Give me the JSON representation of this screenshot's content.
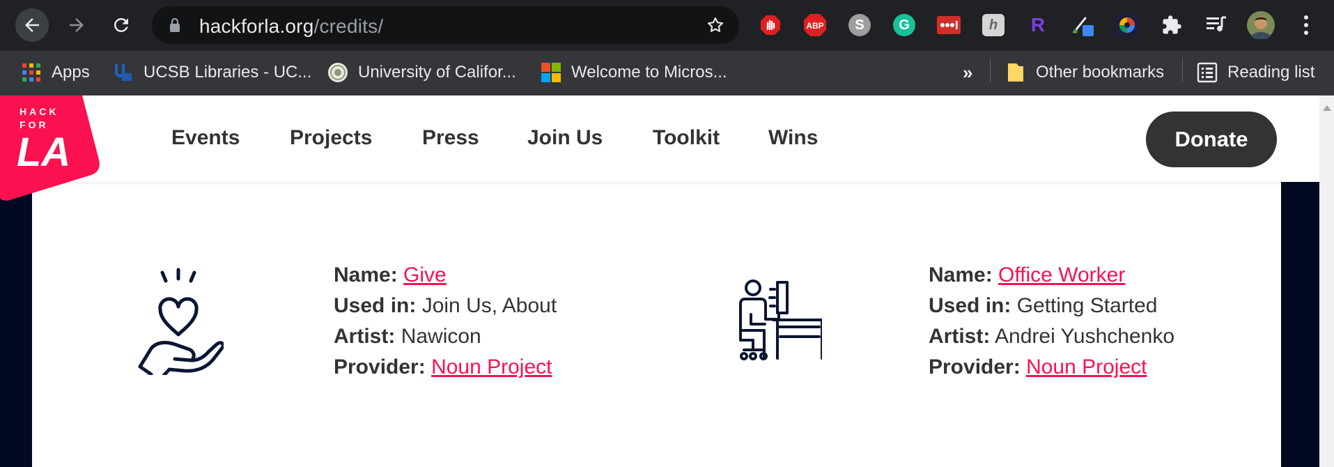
{
  "browser": {
    "url_domain": "hackforla.org",
    "url_path": "/credits/",
    "bookmarks": [
      {
        "label": "Apps"
      },
      {
        "label": "UCSB Libraries - UC..."
      },
      {
        "label": "University of Califor..."
      },
      {
        "label": "Welcome to Micros..."
      }
    ],
    "overflow_label": "»",
    "other_bookmarks": "Other bookmarks",
    "reading_list": "Reading list",
    "extensions": [
      "adblock-hand-icon",
      "abp-icon",
      "skype-icon",
      "grammarly-icon",
      "lastpass-icon",
      "honey-icon",
      "readwise-icon",
      "eyedropper-icon",
      "color-wheel-icon",
      "extensions-puzzle-icon",
      "media-queue-icon",
      "profile-avatar"
    ],
    "ext_labels": {
      "abp": "ABP",
      "s": "S",
      "g": "G",
      "honey": "h",
      "r": "R"
    }
  },
  "site": {
    "logo": {
      "line1": "HACK",
      "line2": "FOR",
      "line3": "LA",
      "color": "#fa114f"
    },
    "nav": [
      "Events",
      "Projects",
      "Press",
      "Join Us",
      "Toolkit",
      "Wins"
    ],
    "donate_label": "Donate",
    "colors": {
      "accent": "#fa114f",
      "navy": "#020a23",
      "text": "#333333"
    }
  },
  "credits": [
    {
      "icon": "give-heart-hand-icon",
      "name_label": "Name:",
      "name": "Give",
      "used_label": "Used in:",
      "used_in": "Join Us, About",
      "artist_label": "Artist:",
      "artist": "Nawicon",
      "provider_label": "Provider:",
      "provider": "Noun Project"
    },
    {
      "icon": "office-worker-icon",
      "name_label": "Name:",
      "name": "Office Worker",
      "used_label": "Used in:",
      "used_in": "Getting Started",
      "artist_label": "Artist:",
      "artist": "Andrei Yushchenko",
      "provider_label": "Provider:",
      "provider": "Noun Project"
    }
  ]
}
